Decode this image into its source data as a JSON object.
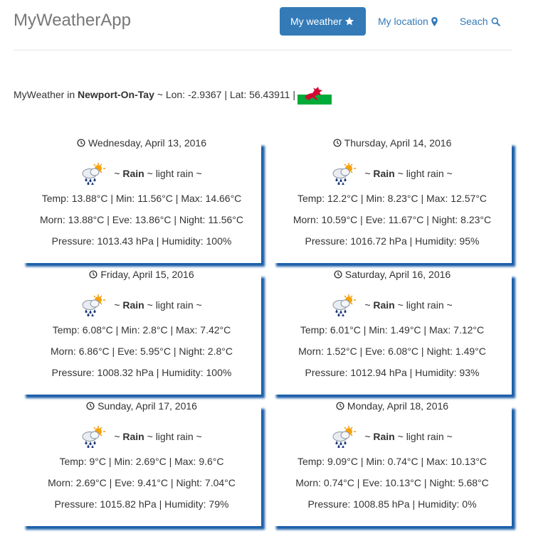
{
  "app_title": "MyWeatherApp",
  "nav": {
    "my_weather": "My weather",
    "my_location": "My location",
    "search": "Seach"
  },
  "location": {
    "prefix": "MyWeather in",
    "city": "Newport-On-Tay",
    "coords": "~ Lon: -2.9367 | Lat: 56.43911 |"
  },
  "colors": {
    "accent": "#337ab7",
    "card_shadow": "#1a5ea8"
  },
  "forecast": [
    {
      "date": "Wednesday, April 13, 2016",
      "main": "Rain",
      "desc": "~ light rain ~",
      "temp": "Temp: 13.88°C | Min: 11.56°C | Max: 14.66°C",
      "parts": "Morn: 13.88°C | Eve: 13.86°C | Night: 11.56°C",
      "pressure": "Pressure: 1013.43 hPa | Humidity: 100%"
    },
    {
      "date": "Thursday, April 14, 2016",
      "main": "Rain",
      "desc": "~ light rain ~",
      "temp": "Temp: 12.2°C | Min: 8.23°C | Max: 12.57°C",
      "parts": "Morn: 10.59°C | Eve: 11.67°C | Night: 8.23°C",
      "pressure": "Pressure: 1016.72 hPa | Humidity: 95%"
    },
    {
      "date": "Friday, April 15, 2016",
      "main": "Rain",
      "desc": "~ light rain ~",
      "temp": "Temp: 6.08°C | Min: 2.8°C | Max: 7.42°C",
      "parts": "Morn: 6.86°C | Eve: 5.95°C | Night: 2.8°C",
      "pressure": "Pressure: 1008.32 hPa | Humidity: 100%"
    },
    {
      "date": "Saturday, April 16, 2016",
      "main": "Rain",
      "desc": "~ light rain ~",
      "temp": "Temp: 6.01°C | Min: 1.49°C | Max: 7.12°C",
      "parts": "Morn: 1.52°C | Eve: 6.08°C | Night: 1.49°C",
      "pressure": "Pressure: 1012.94 hPa | Humidity: 93%"
    },
    {
      "date": "Sunday, April 17, 2016",
      "main": "Rain",
      "desc": "~ light rain ~",
      "temp": "Temp: 9°C | Min: 2.69°C | Max: 9.6°C",
      "parts": "Morn: 2.69°C | Eve: 9.41°C | Night: 7.04°C",
      "pressure": "Pressure: 1015.82 hPa | Humidity: 79%"
    },
    {
      "date": "Monday, April 18, 2016",
      "main": "Rain",
      "desc": "~ light rain ~",
      "temp": "Temp: 9.09°C | Min: 0.74°C | Max: 10.13°C",
      "parts": "Morn: 0.74°C | Eve: 10.13°C | Night: 5.68°C",
      "pressure": "Pressure: 1008.85 hPa | Humidity: 0%"
    }
  ]
}
